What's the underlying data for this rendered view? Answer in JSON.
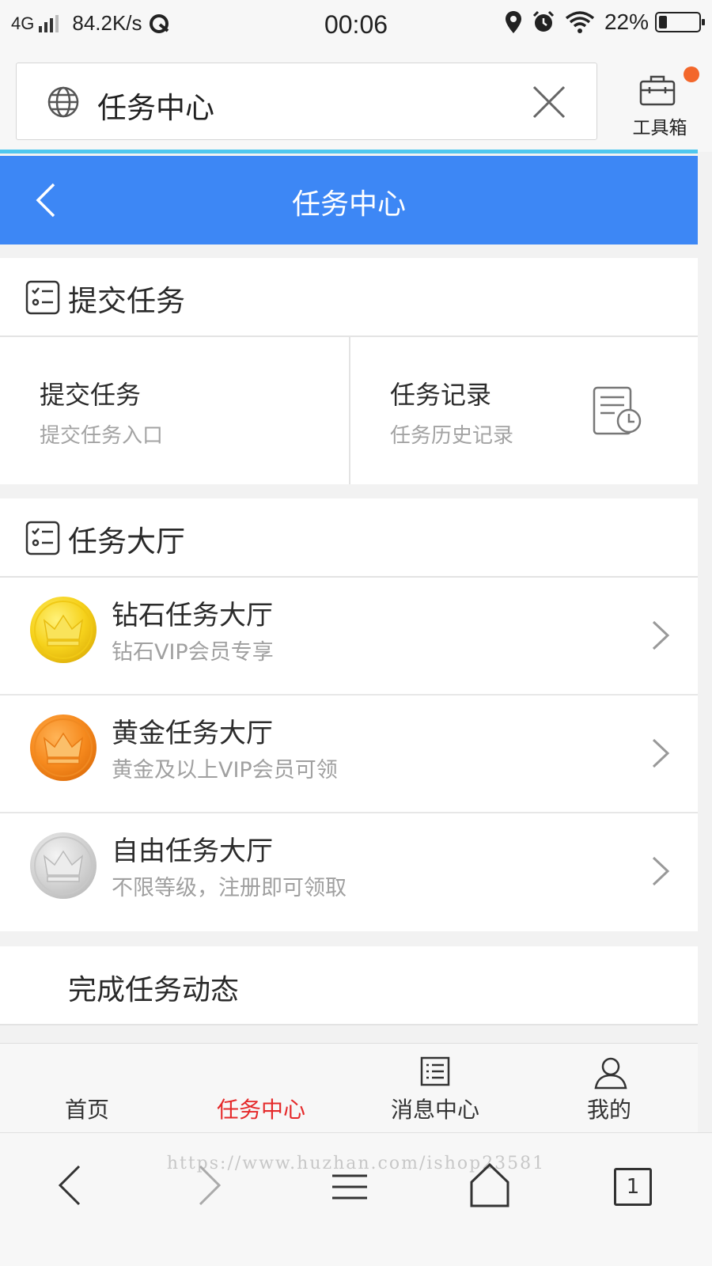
{
  "status_bar": {
    "network": "4G",
    "speed": "84.2K/s",
    "time": "00:06",
    "battery_percent": "22%",
    "battery_level": 0.22
  },
  "address_bar": {
    "text": "任务中心",
    "toolbox_label": "工具箱"
  },
  "header": {
    "title": "任务中心"
  },
  "submit_section": {
    "title": "提交任务",
    "cells": [
      {
        "title": "提交任务",
        "subtitle": "提交任务入口"
      },
      {
        "title": "任务记录",
        "subtitle": "任务历史记录"
      }
    ]
  },
  "hall_section": {
    "title": "任务大厅",
    "items": [
      {
        "title": "钻石任务大厅",
        "subtitle": "钻石VIP会员专享",
        "medal": "gold-crown-medal"
      },
      {
        "title": "黄金任务大厅",
        "subtitle": "黄金及以上VIP会员可领",
        "medal": "orange-crown-medal"
      },
      {
        "title": "自由任务大厅",
        "subtitle": "不限等级，注册即可领取",
        "medal": "silver-crown-medal"
      }
    ]
  },
  "dynamic_section": {
    "title": "完成任务动态"
  },
  "tabbar": {
    "tabs": [
      {
        "label": "首页"
      },
      {
        "label": "任务中心"
      },
      {
        "label": "消息中心"
      },
      {
        "label": "我的"
      }
    ],
    "active_color": "#e5292a"
  },
  "system_nav": {
    "watermark": "https://www.huzhan.com/ishop23581",
    "tab_count": "1"
  },
  "colors": {
    "header_blue": "#3d87f5",
    "notification_dot": "#f3672b",
    "progress": "#4fc7ee"
  }
}
